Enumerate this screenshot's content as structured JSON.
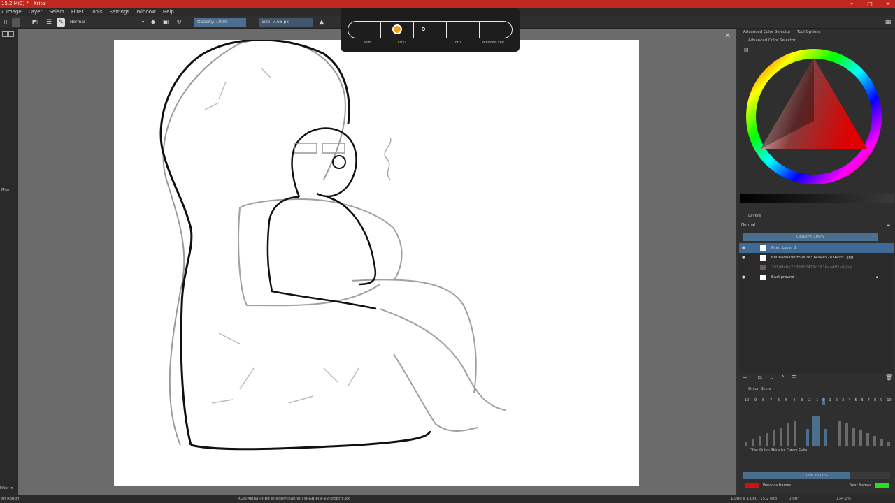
{
  "window": {
    "title": "15.2 MiB) * - Krita"
  },
  "menu": [
    "Image",
    "Layer",
    "Select",
    "Filter",
    "Tools",
    "Settings",
    "Window",
    "Help"
  ],
  "toolbar": {
    "blend_mode": "Normal",
    "opacity": "Opacity: 100%",
    "size": "Size: 7.66 px"
  },
  "keys": {
    "shift": "shift",
    "ctrl_left": "ctrl/z",
    "ctrl": "ctrl",
    "win": "windows key"
  },
  "left_dock": {
    "label1": "Milan",
    "label2": "Filter in"
  },
  "color_panel": {
    "tab1": "Advanced Color Selector",
    "tab2": "Tool Options",
    "title": "Advanced Color Selector"
  },
  "layers": {
    "title": "Layers",
    "blend": "Normal",
    "opacity": "Opacity: 100%",
    "items": [
      {
        "name": "Paint Layer 1"
      },
      {
        "name": "6808adea98f890f7a37404e52e36ccd1.jpg"
      },
      {
        "name": "291dda0a71393b2479d1616aa4ff1e4.jpg"
      },
      {
        "name": "Background"
      }
    ]
  },
  "onion": {
    "title": "Onion Skins",
    "frames": [
      "-10",
      "-9",
      "-8",
      "-7",
      "-6",
      "-5",
      "-4",
      "-3",
      "-2",
      "-1",
      "0",
      "1",
      "2",
      "3",
      "4",
      "5",
      "6",
      "7",
      "8",
      "9",
      "10"
    ],
    "filter_label": "Filter Onion Skins by Frame Color",
    "tint": "Tint: 75.00%",
    "prev": "Previous frames",
    "next": "Next frames",
    "prev_color": "#d11010",
    "next_color": "#22e022"
  },
  "status": {
    "brush": "sh Rough",
    "colorspace": "RGB/Alpha (8-bit integer/channel)  sRGB-elle-V2-srgbtrc.icc",
    "dims": "1,080 x 1,080 (15.2 MiB)",
    "rotation": "0.00°",
    "zoom": "134.0%"
  }
}
